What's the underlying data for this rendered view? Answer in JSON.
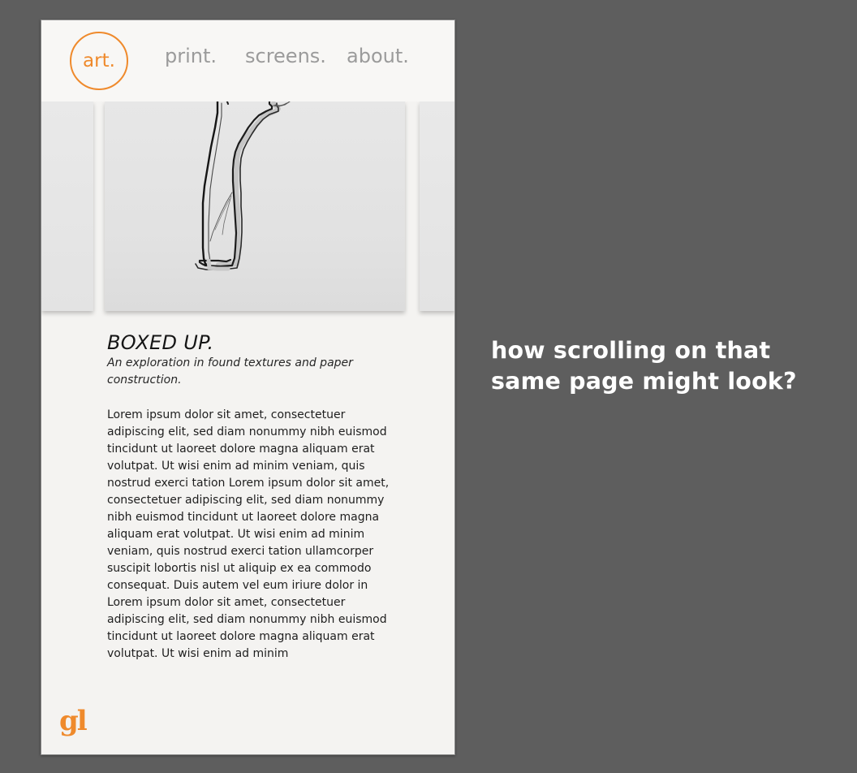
{
  "nav": {
    "logo": "art.",
    "links": [
      "print.",
      "screens.",
      "about."
    ]
  },
  "article": {
    "title": "BOXED UP.",
    "subtitle": "An exploration in found textures and paper construction.",
    "body": "Lorem ipsum dolor sit amet, consectetuer adipiscing elit, sed diam nonummy nibh euismod tincidunt ut laoreet dolore magna aliquam erat volutpat. Ut wisi enim ad minim veniam, quis nostrud exerci tation Lorem ipsum dolor sit amet, consectetuer adipiscing elit, sed diam nonummy nibh euismod tincidunt ut laoreet dolore magna aliquam erat volutpat. Ut wisi enim ad minim veniam, quis nostrud exerci tation ullamcorper suscipit lobortis nisl ut aliquip ex ea commodo consequat. Duis autem vel eum iriure dolor in Lorem ipsum dolor sit amet, consectetuer adipiscing elit, sed diam nonummy nibh euismod tincidunt ut laoreet dolore magna aliquam erat volutpat. Ut wisi enim ad minim"
  },
  "footer": {
    "logo": "gl"
  },
  "caption": "how scrolling on that same page might look?",
  "colors": {
    "background": "#5e5e5e",
    "page": "#f4f3f1",
    "accent": "#ef8a2c",
    "nav_text": "#9b9b9b",
    "caption_text": "#ffffff"
  }
}
